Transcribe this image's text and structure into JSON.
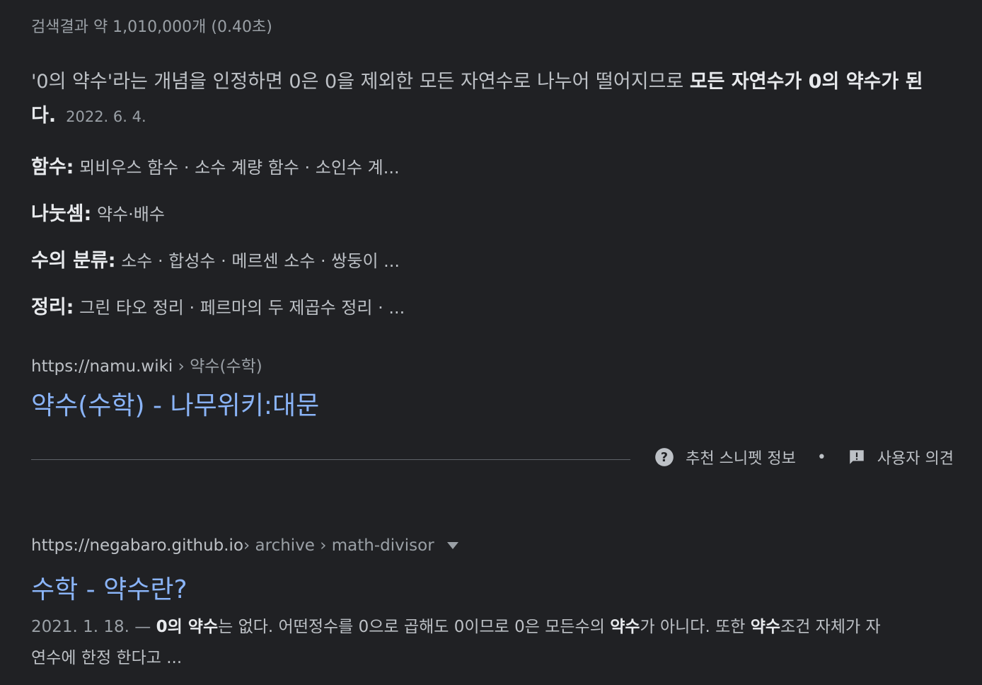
{
  "result_stats": "검색결과 약 1,010,000개 (0.40초)",
  "featured": {
    "text_plain": "'0의 약수'라는 개념을 인정하면 0은 0을 제외한 모든 자연수로 나누어 떨어지므로 ",
    "text_bold": "모든 자연수가 0의 약수가 된다",
    "text_end": ".",
    "date": "2022. 6. 4.",
    "facts": [
      {
        "label": "함수:",
        "value": "뫼비우스 함수 · 소수 계량 함수 · 소인수 계..."
      },
      {
        "label": "나눗셈:",
        "value": "약수·배수"
      },
      {
        "label": "수의 분류:",
        "value": "소수 · 합성수 · 메르센 소수 · 쌍둥이 ..."
      },
      {
        "label": "정리:",
        "value": "그린 타오 정리 · 페르마의 두 제곱수 정리 · ..."
      }
    ],
    "cite_domain": "https://namu.wiki",
    "cite_path": " › 약수(수학)",
    "title": "약수(수학) - 나무위키:대문"
  },
  "footer": {
    "about_label": "추천 스니펫 정보",
    "separator": "•",
    "feedback_label": "사용자 의견"
  },
  "result2": {
    "cite_domain": "https://negabaro.github.io",
    "cite_path": " › archive › math-divisor",
    "title": "수학 - 약수란?",
    "date": "2021. 1. 18.",
    "dash": " — ",
    "s1_bold": "0의 약수",
    "s1": "는 없다. 어떤정수를 0으로 곱해도 0이므로 0은 모든수의 ",
    "s2_bold": "약수",
    "s2": "가 아니다. 또한 ",
    "s3_bold": "약수",
    "s3": "조건 자체가 자연수에 한정 한다고 ..."
  },
  "colors": {
    "background": "#202124",
    "link": "#8ab4f8",
    "text": "#bdc1c6",
    "muted": "#9aa0a6"
  }
}
